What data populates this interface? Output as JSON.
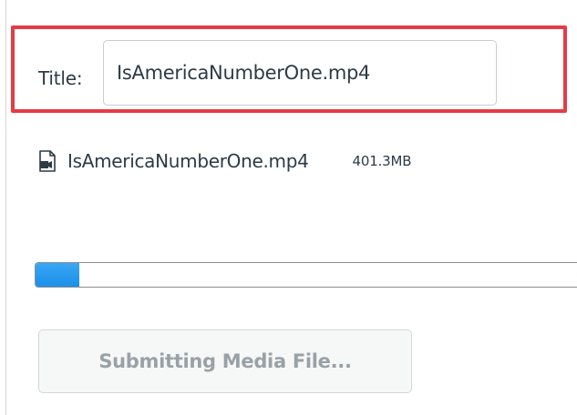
{
  "form": {
    "title_label": "Title:",
    "title_value": "IsAmericaNumberOne.mp4"
  },
  "file": {
    "icon": "video-file-icon",
    "name": "IsAmericaNumberOne.mp4",
    "size": "401.3MB"
  },
  "upload": {
    "progress_percent": 8
  },
  "actions": {
    "submit_label": "Submitting Media File...",
    "submit_disabled": true
  },
  "colors": {
    "highlight_border": "#e53b44",
    "progress_fill": "#2196f3",
    "text": "#2d3b45",
    "disabled_text": "#9aa1a6"
  }
}
